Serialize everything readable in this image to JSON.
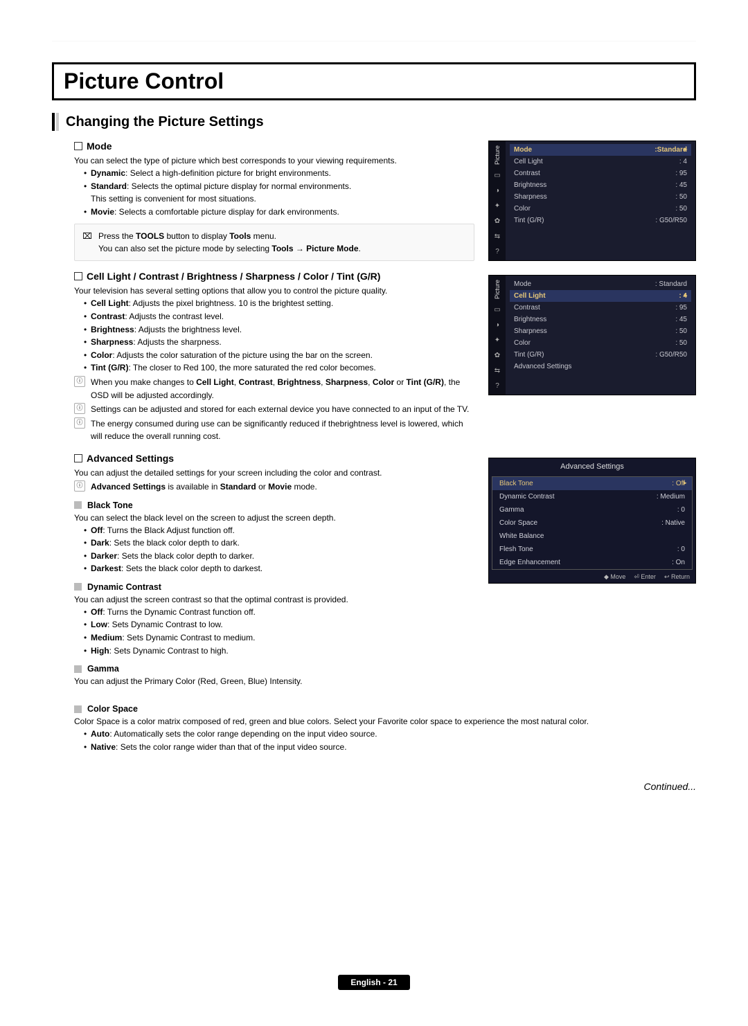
{
  "header": {
    "title": "Picture Control"
  },
  "subtitle": "Changing the Picture Settings",
  "mode": {
    "heading": "Mode",
    "intro": "You can select the type of picture which best corresponds to your viewing requirements.",
    "dynamic_b": "Dynamic",
    "dynamic_t": ": Select a high-definition picture for bright environments.",
    "standard_b": "Standard",
    "standard_t1": ": Selects the optimal picture display for normal environments.",
    "standard_t2": "This setting is convenient for most situations.",
    "movie_b": "Movie",
    "movie_t": ": Selects a comfortable picture display for dark environments.",
    "note1_a": "Press the ",
    "note1_b": "TOOLS",
    "note1_c": " button to display ",
    "note1_d": "Tools",
    "note1_e": " menu.",
    "note2_a": "You can also set the picture mode by selecting ",
    "note2_b": "Tools → Picture Mode",
    "note2_c": "."
  },
  "cl": {
    "heading": "Cell Light / Contrast / Brightness / Sharpness / Color / Tint (G/R)",
    "intro": "Your television has several setting options that allow you to control the picture quality.",
    "li1_b": "Cell Light",
    "li1_t": ": Adjusts the pixel brightness. 10 is the brightest setting.",
    "li2_b": "Contrast",
    "li2_t": ": Adjusts the contrast level.",
    "li3_b": "Brightness",
    "li3_t": ": Adjusts the brightness level.",
    "li4_b": "Sharpness",
    "li4_t": ": Adjusts the sharpness.",
    "li5_b": "Color",
    "li5_t": ": Adjusts the color saturation of the picture using the bar on the screen.",
    "li6_b": "Tint (G/R)",
    "li6_t": ": The closer to Red 100, the more saturated the red color becomes.",
    "n1_a": "When you make changes to ",
    "n1_b": "Cell Light",
    "n1_c": ", ",
    "n1_d": "Contrast",
    "n1_e": ", ",
    "n1_f": "Brightness",
    "n1_g": ", ",
    "n1_h": "Sharpness",
    "n1_i": ", ",
    "n1_j": "Color",
    "n1_k": " or ",
    "n1_l": "Tint (G/R)",
    "n1_m": ", the OSD will be adjusted accordingly.",
    "n2": "Settings can be adjusted and stored for each external device you have connected to an input of the TV.",
    "n3": "The energy consumed during use can be significantly reduced if thebrightness level is lowered, which will reduce the overall running cost."
  },
  "adv": {
    "heading": "Advanced Settings",
    "intro": "You can adjust the detailed settings for your screen including the color and contrast.",
    "note_a": "Advanced Settings",
    "note_b": " is available in ",
    "note_c": "Standard",
    "note_d": " or ",
    "note_e": "Movie",
    "note_f": " mode.",
    "bt_h": "Black Tone",
    "bt_intro": "You can select the black level on the screen to adjust the screen depth.",
    "bt1_b": "Off",
    "bt1_t": ": Turns the Black Adjust function off.",
    "bt2_b": "Dark",
    "bt2_t": ": Sets the black color depth to dark.",
    "bt3_b": "Darker",
    "bt3_t": ": Sets the black color depth to darker.",
    "bt4_b": "Darkest",
    "bt4_t": ": Sets the black color depth to darkest.",
    "dc_h": "Dynamic Contrast",
    "dc_intro": "You can adjust the screen contrast so that the optimal contrast is provided.",
    "dc1_b": "Off",
    "dc1_t": ": Turns the Dynamic Contrast function off.",
    "dc2_b": "Low",
    "dc2_t": ": Sets Dynamic Contrast to low.",
    "dc3_b": "Medium",
    "dc3_t": ": Sets Dynamic Contrast to medium.",
    "dc4_b": "High",
    "dc4_t": ": Sets Dynamic Contrast to high.",
    "g_h": "Gamma",
    "g_intro": "You can adjust the Primary Color (Red, Green, Blue) Intensity.",
    "cs_h": "Color Space",
    "cs_intro": "Color Space is a color matrix composed of red, green and blue colors. Select your Favorite color space to experience the most natural color.",
    "cs1_b": "Auto",
    "cs1_t": ": Automatically sets the color range depending on the input video source.",
    "cs2_b": "Native",
    "cs2_t": ": Sets the color range wider than that of the input video source."
  },
  "osd1": {
    "vlabel": "Picture",
    "rows": [
      {
        "k": "Mode",
        "v": ":Standard",
        "hl": true
      },
      {
        "k": "Cell Light",
        "v": ": 4"
      },
      {
        "k": "Contrast",
        "v": ": 95"
      },
      {
        "k": "Brightness",
        "v": ": 45"
      },
      {
        "k": "Sharpness",
        "v": ": 50"
      },
      {
        "k": "Color",
        "v": ": 50"
      },
      {
        "k": "Tint (G/R)",
        "v": ": G50/R50"
      }
    ]
  },
  "osd2": {
    "vlabel": "Picture",
    "rows": [
      {
        "k": "Mode",
        "v": ": Standard"
      },
      {
        "k": "Cell Light",
        "v": ": 4",
        "hl": true
      },
      {
        "k": "Contrast",
        "v": ": 95"
      },
      {
        "k": "Brightness",
        "v": ": 45"
      },
      {
        "k": "Sharpness",
        "v": ": 50"
      },
      {
        "k": "Color",
        "v": ": 50"
      },
      {
        "k": "Tint (G/R)",
        "v": ": G50/R50"
      },
      {
        "k": "Advanced Settings",
        "v": ""
      }
    ]
  },
  "osd3": {
    "title": "Advanced Settings",
    "rows": [
      {
        "k": "Black Tone",
        "v": ": Off",
        "first": true
      },
      {
        "k": "Dynamic Contrast",
        "v": ": Medium"
      },
      {
        "k": "Gamma",
        "v": ": 0"
      },
      {
        "k": "Color Space",
        "v": ": Native"
      },
      {
        "k": "White Balance",
        "v": ""
      },
      {
        "k": "Flesh Tone",
        "v": ": 0"
      },
      {
        "k": "Edge Enhancement",
        "v": ": On"
      }
    ],
    "footer": {
      "move": "Move",
      "enter": "Enter",
      "return": "Return"
    }
  },
  "continued": "Continued...",
  "footer": "English - 21",
  "icons": {
    "note": "ⓘ",
    "tools": "⌧"
  }
}
